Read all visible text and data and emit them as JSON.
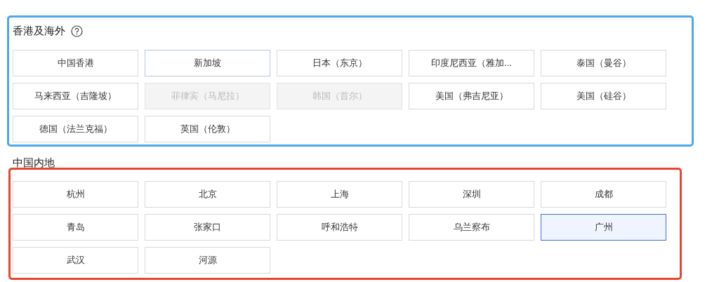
{
  "sections": [
    {
      "title": "香港及海外",
      "help_icon": true,
      "color": "#4aa8f0",
      "regions": [
        {
          "label": "中国香港",
          "selected": false,
          "disabled": false,
          "hovered": false
        },
        {
          "label": "新加坡",
          "selected": false,
          "disabled": false,
          "hovered": true
        },
        {
          "label": "日本（东京）",
          "selected": false,
          "disabled": false,
          "hovered": false
        },
        {
          "label": "印度尼西亚（雅加...",
          "selected": false,
          "disabled": false,
          "hovered": false
        },
        {
          "label": "泰国（曼谷）",
          "selected": false,
          "disabled": false,
          "hovered": false
        },
        {
          "label": "马来西亚（吉隆坡）",
          "selected": false,
          "disabled": false,
          "hovered": false
        },
        {
          "label": "菲律宾（马尼拉）",
          "selected": false,
          "disabled": true,
          "hovered": false
        },
        {
          "label": "韩国（首尔）",
          "selected": false,
          "disabled": true,
          "hovered": false
        },
        {
          "label": "美国（弗吉尼亚）",
          "selected": false,
          "disabled": false,
          "hovered": false
        },
        {
          "label": "美国（硅谷）",
          "selected": false,
          "disabled": false,
          "hovered": false
        },
        {
          "label": "德国（法兰克福）",
          "selected": false,
          "disabled": false,
          "hovered": false
        },
        {
          "label": "英国（伦敦）",
          "selected": false,
          "disabled": false,
          "hovered": false
        }
      ]
    },
    {
      "title": "中国内地",
      "help_icon": false,
      "color": "#e8452c",
      "regions": [
        {
          "label": "杭州",
          "selected": false,
          "disabled": false,
          "hovered": false
        },
        {
          "label": "北京",
          "selected": false,
          "disabled": false,
          "hovered": false
        },
        {
          "label": "上海",
          "selected": false,
          "disabled": false,
          "hovered": false
        },
        {
          "label": "深圳",
          "selected": false,
          "disabled": false,
          "hovered": false
        },
        {
          "label": "成都",
          "selected": false,
          "disabled": false,
          "hovered": false
        },
        {
          "label": "青岛",
          "selected": false,
          "disabled": false,
          "hovered": false
        },
        {
          "label": "张家口",
          "selected": false,
          "disabled": false,
          "hovered": false
        },
        {
          "label": "呼和浩特",
          "selected": false,
          "disabled": false,
          "hovered": false
        },
        {
          "label": "乌兰察布",
          "selected": false,
          "disabled": false,
          "hovered": false
        },
        {
          "label": "广州",
          "selected": true,
          "disabled": false,
          "hovered": false
        },
        {
          "label": "武汉",
          "selected": false,
          "disabled": false,
          "hovered": false
        },
        {
          "label": "河源",
          "selected": false,
          "disabled": false,
          "hovered": false
        }
      ]
    }
  ]
}
